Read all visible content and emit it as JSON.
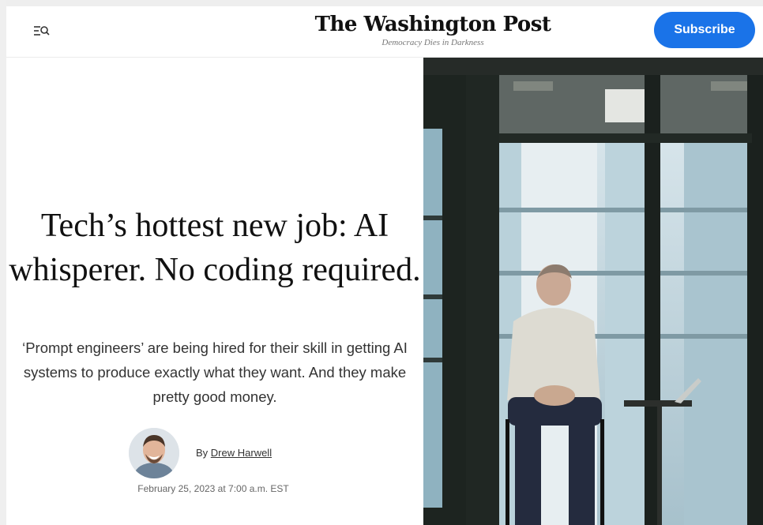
{
  "header": {
    "menu_icon": "menu-search-icon",
    "masthead": "The Washington Post",
    "tagline": "Democracy Dies in Darkness",
    "subscribe_label": "Subscribe"
  },
  "article": {
    "headline": "Tech’s hottest new job: AI whisperer. No coding required.",
    "dek": "‘Prompt engineers’ are being hired for their skill in getting AI systems to produce exactly what they want. And they make pretty good money.",
    "byline_prefix": "By",
    "author": "Drew Harwell",
    "timestamp": "February 25, 2023 at 7:00 a.m. EST"
  },
  "colors": {
    "subscribe_bg": "#1a73e8",
    "text": "#111111"
  }
}
